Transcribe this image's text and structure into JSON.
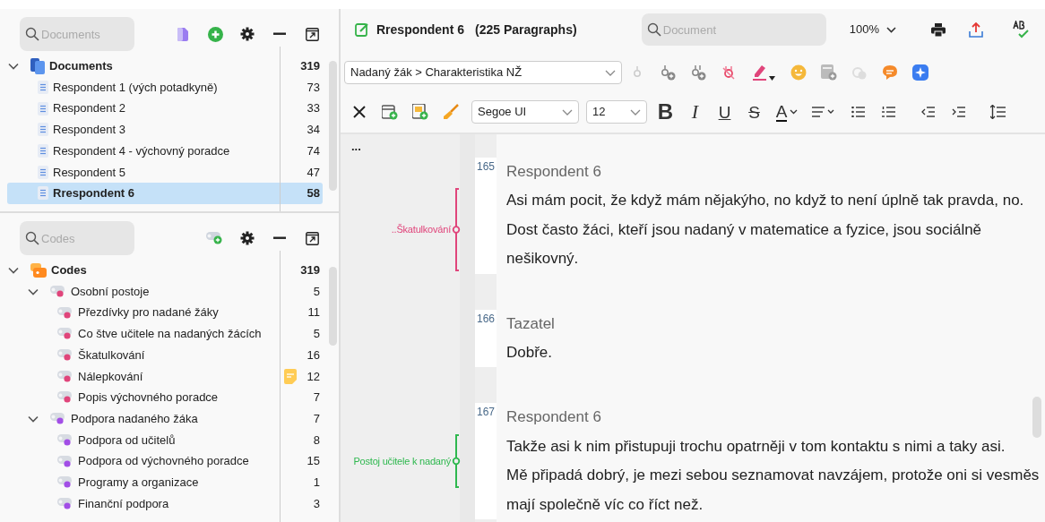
{
  "documents_panel": {
    "search": {
      "placeholder": "Documents"
    },
    "root": {
      "label": "Documents",
      "count": "319",
      "expanded": true,
      "children": [
        {
          "label": "Respondent 1 (vých potadkyně)",
          "count": "73",
          "selected": false
        },
        {
          "label": "Respondent 2",
          "count": "33",
          "selected": false
        },
        {
          "label": "Respondent 3",
          "count": "34",
          "selected": false
        },
        {
          "label": "Respondent 4 - výchovný poradce",
          "count": "74",
          "selected": false
        },
        {
          "label": "Respondent 5",
          "count": "47",
          "selected": false
        },
        {
          "label": "Rrespondent 6",
          "count": "58",
          "selected": true
        }
      ]
    }
  },
  "codes_panel": {
    "search": {
      "placeholder": "Codes"
    },
    "root": {
      "label": "Codes",
      "count": "319",
      "expanded": true,
      "children": [
        {
          "label": "Osobní postoje",
          "count": "5",
          "color": "#e0457b",
          "expanded": true,
          "children": [
            {
              "label": "Přezdívky pro nadané žáky",
              "count": "11",
              "color": "#e0457b"
            },
            {
              "label": "Co štve učitele na nadaných žácích",
              "count": "5",
              "color": "#e0457b"
            },
            {
              "label": "Škatulkování",
              "count": "16",
              "color": "#e0457b"
            },
            {
              "label": "Nálepkování",
              "count": "12",
              "color": "#e0457b",
              "memo": true
            },
            {
              "label": "Popis výchovného poradce",
              "count": "7",
              "color": "#e0457b"
            }
          ]
        },
        {
          "label": "Podpora nadaného žáka",
          "count": "7",
          "color": "#a24ee6",
          "expanded": true,
          "children": [
            {
              "label": "Podpora od učitelů",
              "count": "8",
              "color": "#a24ee6"
            },
            {
              "label": "Podpora od výchovného poradce",
              "count": "15",
              "color": "#a24ee6"
            },
            {
              "label": "Programy a organizace",
              "count": "1",
              "color": "#a24ee6"
            },
            {
              "label": "Finanční podpora",
              "count": "3",
              "color": "#a24ee6"
            }
          ]
        }
      ]
    }
  },
  "document": {
    "title": "Rrespondent 6",
    "paragraph_count": "(225 Paragraphs)",
    "search": {
      "placeholder": "Document"
    },
    "zoom": "100%",
    "code_select": "Nadaný žák > Charakteristika NŽ",
    "font": "Segoe UI",
    "font_size": "12",
    "format_buttons": [
      {
        "label": "B",
        "kind": "bold"
      },
      {
        "label": "I",
        "kind": "italic"
      },
      {
        "label": "U",
        "kind": "underline"
      },
      {
        "label": "S",
        "kind": "strike"
      },
      {
        "label": "A",
        "kind": "color"
      }
    ],
    "more": "...",
    "paragraphs": [
      {
        "number": "165",
        "speaker": "Respondent 6",
        "code": {
          "label": "..Škatulkování",
          "color": "#e0457b"
        },
        "lines": [
          "Asi mám pocit, že když mám nějakýho, no když to není úplně tak pravda, no.",
          "Dost často žáci, kteří jsou nadaný v matematice a fyzice, jsou sociálně",
          "nešikovný."
        ]
      },
      {
        "number": "166",
        "speaker": "Tazatel",
        "lines": [
          "Dobře."
        ]
      },
      {
        "number": "167",
        "speaker": "Respondent 6",
        "code": {
          "label": "Postoj učitele k nadaný",
          "color": "#2fb84f"
        },
        "lines": [
          "Takže asi k nim přistupuji trochu opatrněji v tom kontaktu s nimi a taky asi.",
          "Mě připadá dobrý, je mezi sebou seznamovat navzájem, protože oni si vesměs"
        ],
        "uncoded_lines": [
          "mají společně víc co říct než."
        ]
      }
    ]
  }
}
